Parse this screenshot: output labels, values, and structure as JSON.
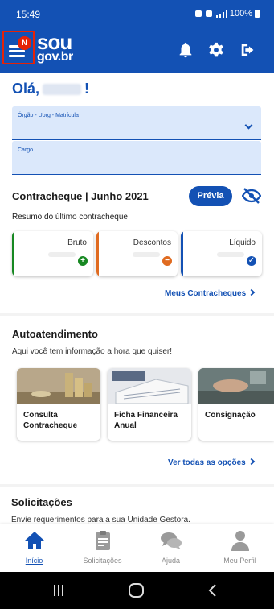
{
  "status_bar": {
    "time": "15:49",
    "battery": "100%"
  },
  "header": {
    "menu_badge": "N",
    "logo_line1": "sou",
    "logo_line2": "gov.br"
  },
  "greeting": {
    "text": "Olá,",
    "suffix": "!"
  },
  "fields": {
    "orgao_label": "Órgão - Uorg - Matrícula",
    "cargo_label": "Cargo"
  },
  "contracheque": {
    "title": "Contracheque | Junho 2021",
    "preview_button": "Prévia",
    "subtitle": "Resumo do último contracheque",
    "cards": [
      {
        "label": "Bruto",
        "color": "#168821",
        "icon": "plus-icon"
      },
      {
        "label": "Descontos",
        "color": "#e06b20",
        "icon": "minus-icon"
      },
      {
        "label": "Líquido",
        "color": "#1351b4",
        "icon": "check-icon"
      }
    ],
    "link": "Meus Contracheques"
  },
  "autoatendimento": {
    "title": "Autoatendimento",
    "subtitle": "Aqui você tem informação a hora que quiser!",
    "tiles": [
      {
        "line1": "Consulta",
        "line2": "Contracheque"
      },
      {
        "line1": "Ficha Financeira",
        "line2": "Anual"
      },
      {
        "line1": "Consignação",
        "line2": ""
      }
    ],
    "link": "Ver todas as opções"
  },
  "solicitacoes": {
    "title": "Solicitações",
    "subtitle": "Envie requerimentos para a sua Unidade Gestora."
  },
  "bottom_nav": [
    {
      "label": "Início",
      "icon": "home-icon",
      "active": true
    },
    {
      "label": "Solicitações",
      "icon": "clipboard-icon",
      "active": false
    },
    {
      "label": "Ajuda",
      "icon": "chat-icon",
      "active": false
    },
    {
      "label": "Meu Perfil",
      "icon": "person-icon",
      "active": false
    }
  ],
  "colors": {
    "primary": "#1351b4",
    "alert": "#e52207",
    "field_bg": "#dbe8fb"
  }
}
